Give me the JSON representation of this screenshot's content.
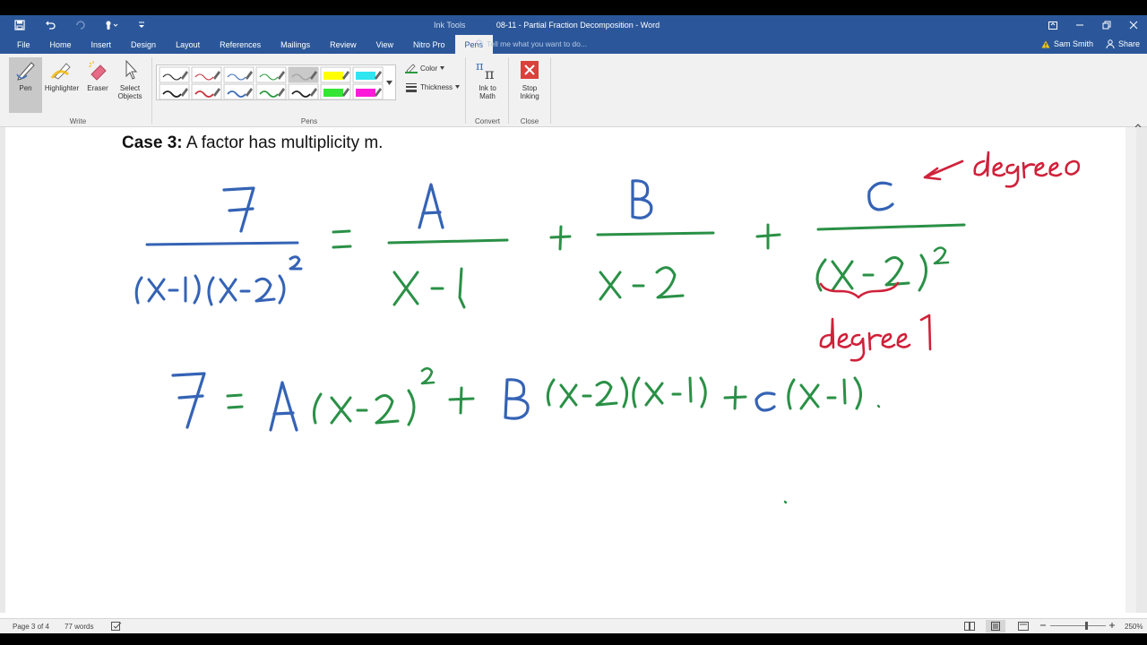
{
  "title_bar": {
    "contextual_group": "Ink Tools",
    "window_title": "08-11 - Partial Fraction Decomposition - Word"
  },
  "tabs": [
    {
      "label": "File"
    },
    {
      "label": "Home"
    },
    {
      "label": "Insert"
    },
    {
      "label": "Design"
    },
    {
      "label": "Layout"
    },
    {
      "label": "References"
    },
    {
      "label": "Mailings"
    },
    {
      "label": "Review"
    },
    {
      "label": "View"
    },
    {
      "label": "Nitro Pro"
    },
    {
      "label": "Pens"
    }
  ],
  "tell_me": {
    "placeholder": "Tell me what you want to do..."
  },
  "account": {
    "user": "Sam Smith",
    "share_label": "Share"
  },
  "ribbon": {
    "write": {
      "pen_label": "Pen",
      "highlighter_label": "Highlighter",
      "eraser_label": "Eraser",
      "select_label_1": "Select",
      "select_label_2": "Objects",
      "group_label": "Write"
    },
    "pens": {
      "group_label": "Pens",
      "color_label": "Color",
      "thickness_label": "Thickness"
    },
    "convert": {
      "ink_label_1": "Ink to",
      "ink_label_2": "Math",
      "group_label": "Convert"
    },
    "close": {
      "stop_label_1": "Stop",
      "stop_label_2": "Inking",
      "group_label": "Close"
    },
    "colors": {
      "black": "#222222",
      "red": "#c8323c",
      "blue": "#3b6cb7",
      "green": "#2a9a3e",
      "gray": "#9a9a9a",
      "yellow": "#ffff00",
      "cyan": "#2ee6f0",
      "lime": "#33e633",
      "magenta": "#ff1ad9"
    }
  },
  "document": {
    "heading_bold": "Case 3:",
    "heading_rest": " A factor has multiplicity m.",
    "ink_colors": {
      "blue": "#3563b5",
      "green": "#2a9046",
      "red": "#d0213a"
    }
  },
  "status": {
    "page": "Page 3 of 4",
    "words": "77 words",
    "zoom": "250%"
  }
}
